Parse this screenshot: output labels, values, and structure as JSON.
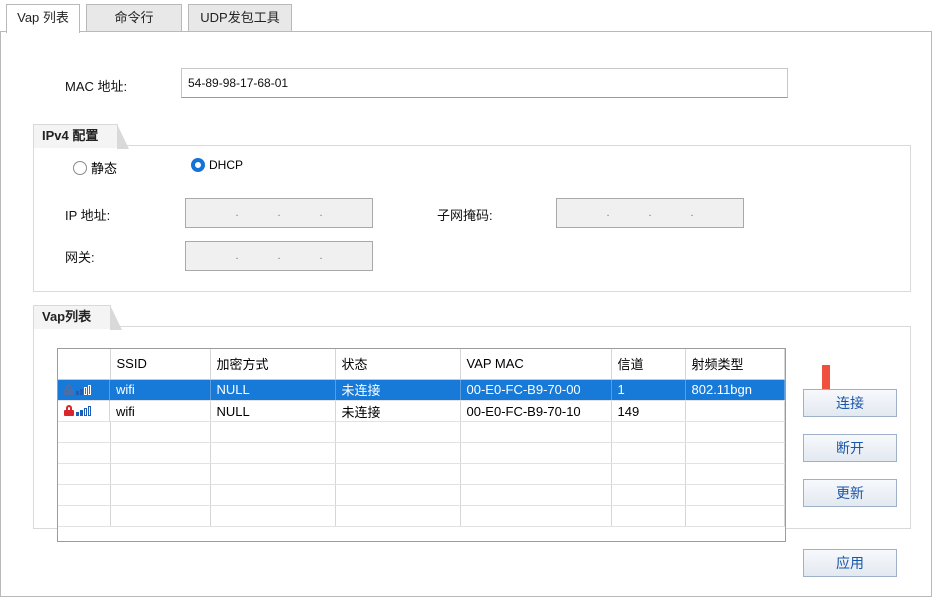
{
  "tabs": [
    "Vap 列表",
    "命令行",
    "UDP发包工具"
  ],
  "mac": {
    "label": "MAC 地址:",
    "value": "54-89-98-17-68-01"
  },
  "ipv4": {
    "title": "IPv4 配置",
    "static_label": "静态",
    "dhcp_label": "DHCP",
    "ip_label": "IP 地址:",
    "mask_label": "子网掩码:",
    "gateway_label": "网关:",
    "ip_dots": [
      ".",
      ".",
      "."
    ],
    "mask_dots": [
      ".",
      ".",
      "."
    ],
    "gateway_dots": [
      ".",
      ".",
      "."
    ]
  },
  "vap": {
    "title": "Vap列表",
    "columns": [
      "",
      "SSID",
      "加密方式",
      "状态",
      "VAP MAC",
      "信道",
      "射频类型"
    ],
    "rows": [
      {
        "ssid": "wifi",
        "enc": "NULL",
        "status": "未连接",
        "mac": "00-E0-FC-B9-70-00",
        "channel": "1",
        "radio": "802.11bgn",
        "lock_color": "#4b6ea8",
        "selected": true
      },
      {
        "ssid": "wifi",
        "enc": "NULL",
        "status": "未连接",
        "mac": "00-E0-FC-B9-70-10",
        "channel": "149",
        "radio": "",
        "lock_color": "#d9262b",
        "selected": false
      }
    ]
  },
  "buttons": {
    "connect": "连接",
    "disconnect": "断开",
    "refresh": "更新",
    "apply": "应用"
  },
  "colors": {
    "selection": "#1779d8",
    "accent": "#1572d6",
    "arrow": "#f0513e"
  }
}
